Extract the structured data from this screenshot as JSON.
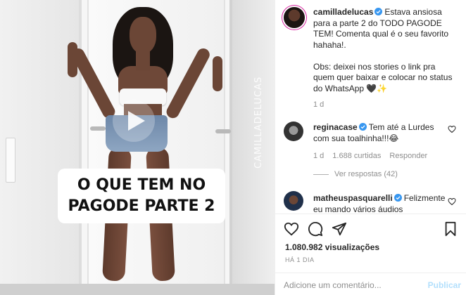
{
  "video": {
    "caption_lines": [
      "O QUE TEM NO",
      "PAGODE PARTE 2"
    ],
    "watermark": "CAMILLADELUCAS"
  },
  "post": {
    "author": "camilladelucas",
    "caption": "Estava ansiosa para a parte 2 do TODO PAGODE TEM! Comenta qual é o seu favorito hahaha!.\n\nObs: deixei nos stories o link pra quem quer baixar e colocar no status do WhatsApp 🖤✨",
    "time": "1 d"
  },
  "comments": [
    {
      "user": "reginacase",
      "text": "Tem até a Lurdes com sua toalhinha!!!😂",
      "time": "1 d",
      "likes": "1.688 curtidas",
      "reply_label": "Responder",
      "view_replies": "Ver respostas (42)"
    },
    {
      "user": "matheuspasquarelli",
      "text": "Felizmente eu mando vários áudios"
    }
  ],
  "stats": {
    "views": "1.080.982 visualizações",
    "posted": "HÁ 1 DIA"
  },
  "composer": {
    "placeholder": "Adicione um comentário...",
    "publish_label": "Publicar"
  },
  "colors": {
    "verified": "#3897f0",
    "muted": "#8e8e8e",
    "publish": "#b2dffc"
  },
  "icons": [
    "play-icon",
    "verified-icon",
    "heart-icon",
    "comment-icon",
    "share-icon",
    "bookmark-icon"
  ]
}
